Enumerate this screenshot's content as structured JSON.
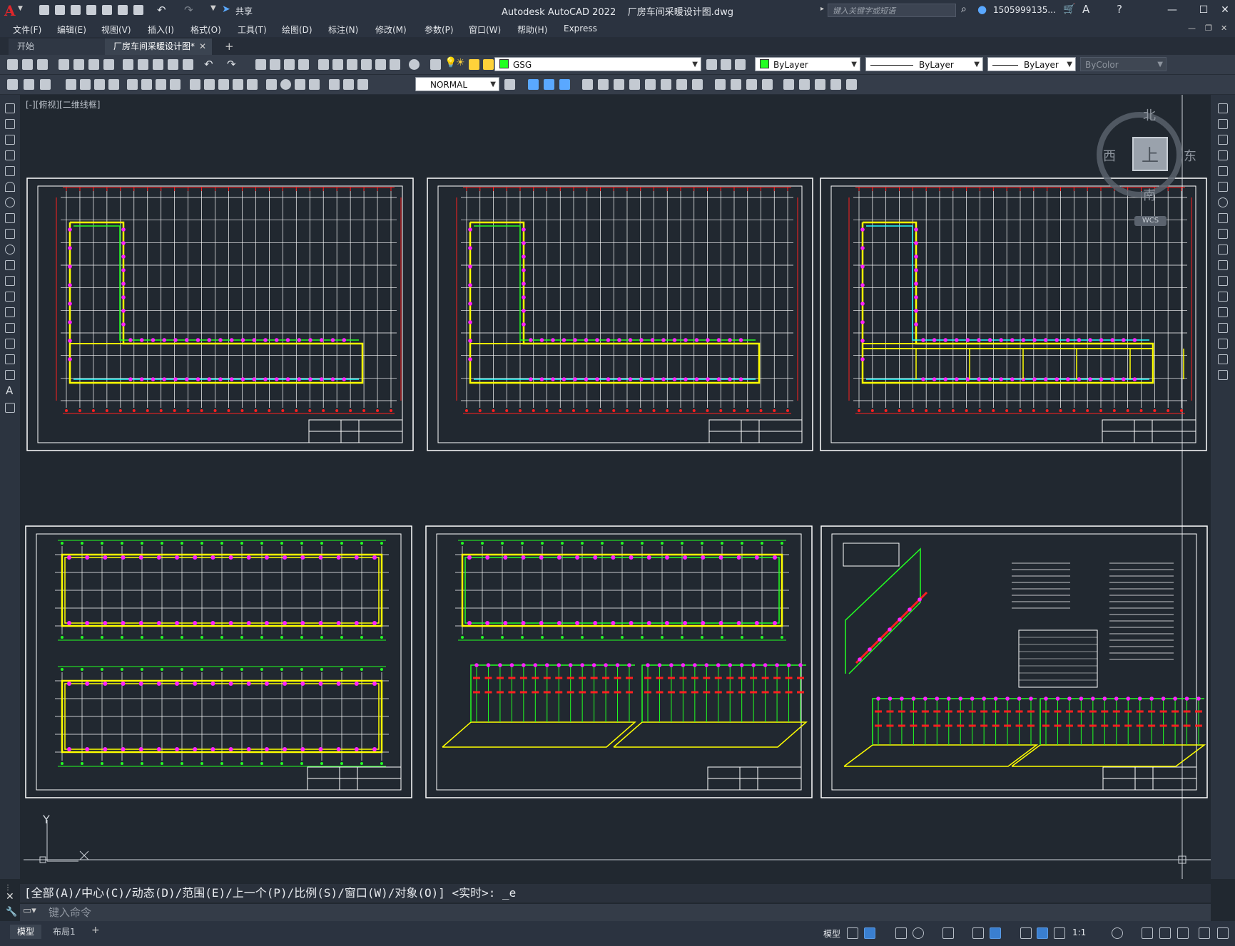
{
  "title_bar": {
    "app_name": "Autodesk AutoCAD 2022",
    "file_name": "厂房车间采暖设计图.dwg",
    "search_placeholder": "键入关键字或短语",
    "user": "1505999135...",
    "share_label": "共享",
    "logo": "A"
  },
  "menu": [
    "文件(F)",
    "编辑(E)",
    "视图(V)",
    "插入(I)",
    "格式(O)",
    "工具(T)",
    "绘图(D)",
    "标注(N)",
    "修改(M)",
    "参数(P)",
    "窗口(W)",
    "帮助(H)",
    "Express"
  ],
  "tabs": {
    "start": "开始",
    "drawing": "厂房车间采暖设计图*",
    "add": "+"
  },
  "toolbar": {
    "layer_name": "GSG",
    "color": "ByLayer",
    "linetype": "ByLayer",
    "lineweight": "ByLayer",
    "plot_style": "ByColor",
    "dim_style": "NORMAL"
  },
  "viewport": {
    "label": "[-][俯视][二维线框]",
    "viewcube_top": "上",
    "north": "北",
    "south": "南",
    "east": "东",
    "west": "西",
    "wcs": "WCS"
  },
  "ucs": {
    "y_label": "Y"
  },
  "command": {
    "history": "[全部(A)/中心(C)/动态(D)/范围(E)/上一个(P)/比例(S)/窗口(W)/对象(O)] <实时>: _e",
    "input_placeholder": "键入命令"
  },
  "status": {
    "model_tab": "模型",
    "layout_tab": "布局1",
    "add_tab": "+",
    "model_label": "模型",
    "scale": "1:1"
  },
  "colors": {
    "canvas": "#212830",
    "red": "#ff2020",
    "yellow": "#ffff00",
    "green": "#22ff22",
    "magenta": "#ff22ff",
    "cyan": "#22ffff",
    "white": "#ffffff"
  }
}
